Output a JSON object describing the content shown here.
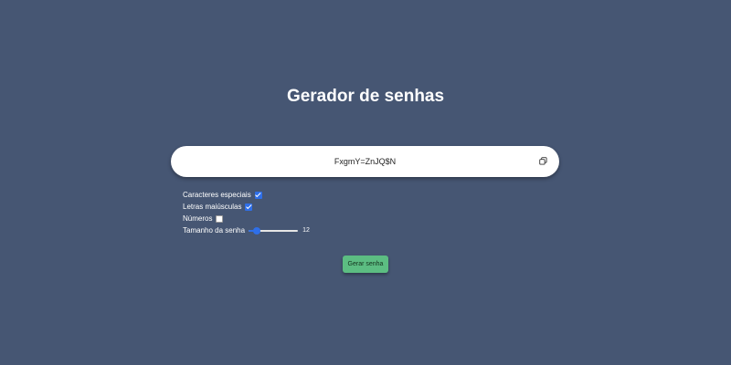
{
  "page": {
    "title": "Gerador de senhas"
  },
  "password": {
    "value": "FxgmY=ZnJQ$N",
    "copy_icon": "copy-icon"
  },
  "options": {
    "special_chars": {
      "label": "Caracteres especiais",
      "checked": true
    },
    "uppercase": {
      "label": "Letras maiúsculas",
      "checked": true
    },
    "numbers": {
      "label": "Números",
      "checked": false
    },
    "length": {
      "label": "Tamanho da senha",
      "value": 12,
      "value_text": "12",
      "min": 8,
      "max": 32
    }
  },
  "actions": {
    "generate_label": "Gerar senha"
  },
  "colors": {
    "background": "#465673",
    "accent": "#2f6fe8",
    "button": "#5cbd82"
  }
}
